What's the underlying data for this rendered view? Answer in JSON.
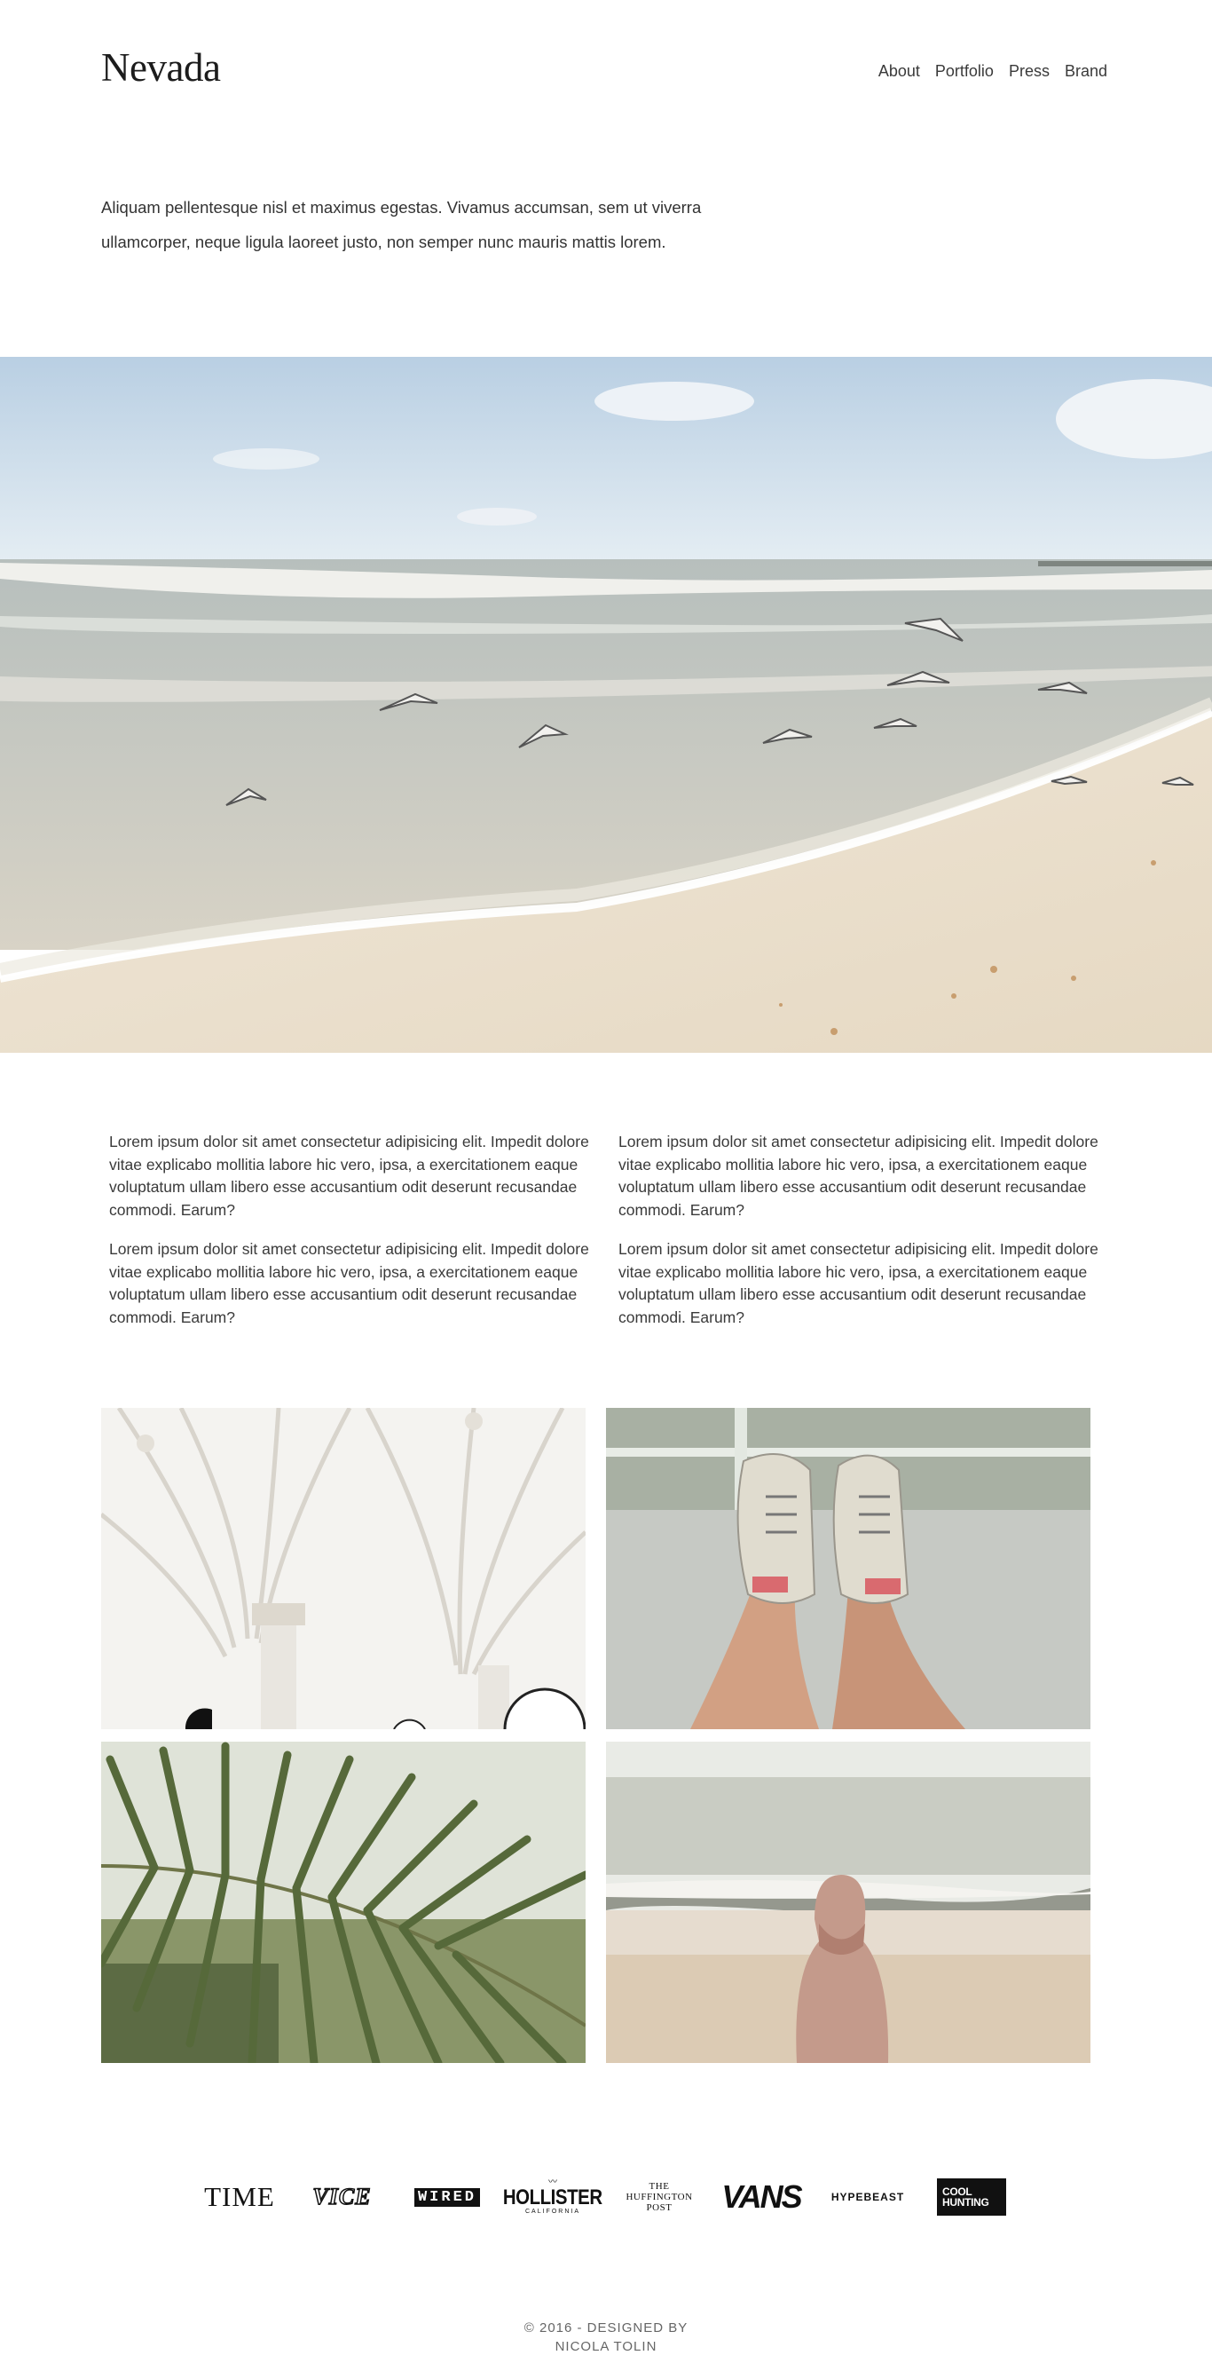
{
  "header": {
    "logo": "Nevada",
    "nav": [
      {
        "label": "About"
      },
      {
        "label": "Portfolio"
      },
      {
        "label": "Press"
      },
      {
        "label": "Brand"
      }
    ]
  },
  "intro": {
    "text": "Aliquam pellentesque nisl et maximus egestas. Vivamus accumsan, sem ut viverra ullamcorper, neque ligula laoreet justo, non semper nunc mauris mattis lorem."
  },
  "content": {
    "columns": [
      {
        "paragraphs": [
          "Lorem ipsum dolor sit amet consectetur adipisicing elit. Impedit dolore vitae explicabo mollitia labore hic vero, ipsa, a exercitationem eaque voluptatum ullam libero esse accusantium odit deserunt recusandae commodi. Earum?",
          "Lorem ipsum dolor sit amet consectetur adipisicing elit. Impedit dolore vitae explicabo mollitia labore hic vero, ipsa, a exercitationem eaque voluptatum ullam libero esse accusantium odit deserunt recusandae commodi. Earum?"
        ]
      },
      {
        "paragraphs": [
          "Lorem ipsum dolor sit amet consectetur adipisicing elit. Impedit dolore vitae explicabo mollitia labore hic vero, ipsa, a exercitationem eaque voluptatum ullam libero esse accusantium odit deserunt recusandae commodi. Earum?",
          "Lorem ipsum dolor sit amet consectetur adipisicing elit. Impedit dolore vitae explicabo mollitia labore hic vero, ipsa, a exercitationem eaque voluptatum ullam libero esse accusantium odit deserunt recusandae commodi. Earum?"
        ]
      }
    ]
  },
  "brands": [
    {
      "name": "TIME"
    },
    {
      "name": "VICE"
    },
    {
      "name": "WIRED"
    },
    {
      "name": "HOLLISTER",
      "sub": "CALIFORNIA"
    },
    {
      "name": "THE",
      "line2": "HUFFINGTON",
      "line3": "POST"
    },
    {
      "name": "VANS"
    },
    {
      "name": "HYPEBEAST"
    },
    {
      "name": "COOL",
      "line2": "HUNTING"
    }
  ],
  "footer": {
    "line1": "© 2016 - DESIGNED BY",
    "line2": "NICOLA TOLIN"
  }
}
